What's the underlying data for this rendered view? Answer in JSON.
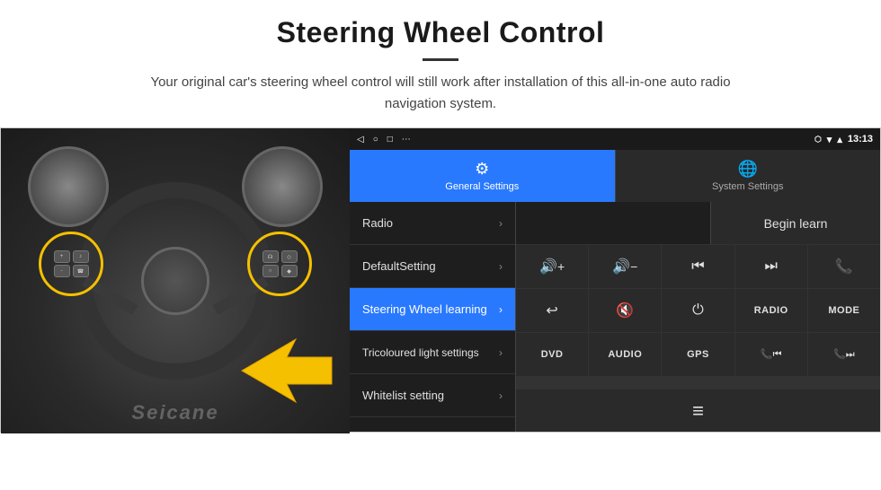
{
  "header": {
    "title": "Steering Wheel Control",
    "subtitle": "Your original car's steering wheel control will still work after installation of this all-in-one auto radio navigation system."
  },
  "statusBar": {
    "back_icon": "◁",
    "circle_icon": "○",
    "square_icon": "□",
    "dots_icon": "⋯",
    "wifi_icon": "▾",
    "signal_icon": "▴",
    "time": "13:13"
  },
  "tabs": [
    {
      "label": "General Settings",
      "active": true
    },
    {
      "label": "System Settings",
      "active": false
    }
  ],
  "menu": {
    "items": [
      {
        "label": "Radio",
        "active": false
      },
      {
        "label": "DefaultSetting",
        "active": false
      },
      {
        "label": "Steering Wheel learning",
        "active": true
      },
      {
        "label": "Tricoloured light settings",
        "active": false
      },
      {
        "label": "Whitelist setting",
        "active": false
      }
    ]
  },
  "panel": {
    "begin_learn_label": "Begin learn",
    "buttons": [
      {
        "icon": "🔊+",
        "type": "icon",
        "label": "vol-up"
      },
      {
        "icon": "🔊-",
        "type": "icon",
        "label": "vol-down"
      },
      {
        "icon": "⏮",
        "type": "icon",
        "label": "prev"
      },
      {
        "icon": "⏭",
        "type": "icon",
        "label": "next"
      },
      {
        "icon": "📞",
        "type": "icon",
        "label": "phone"
      },
      {
        "icon": "↩",
        "type": "icon",
        "label": "back"
      },
      {
        "icon": "🔇",
        "type": "icon",
        "label": "mute"
      },
      {
        "icon": "⏻",
        "type": "icon",
        "label": "power"
      },
      {
        "text": "RADIO",
        "type": "text",
        "label": "radio"
      },
      {
        "text": "MODE",
        "type": "text",
        "label": "mode"
      },
      {
        "text": "DVD",
        "type": "text",
        "label": "dvd"
      },
      {
        "text": "AUDIO",
        "type": "text",
        "label": "audio"
      },
      {
        "text": "GPS",
        "type": "text",
        "label": "gps"
      },
      {
        "icon": "📞⏮",
        "type": "icon",
        "label": "phone-prev"
      },
      {
        "icon": "📞⏭",
        "type": "icon",
        "label": "phone-next"
      }
    ],
    "last_row_icon": "≡"
  },
  "watermark": "Seicane"
}
